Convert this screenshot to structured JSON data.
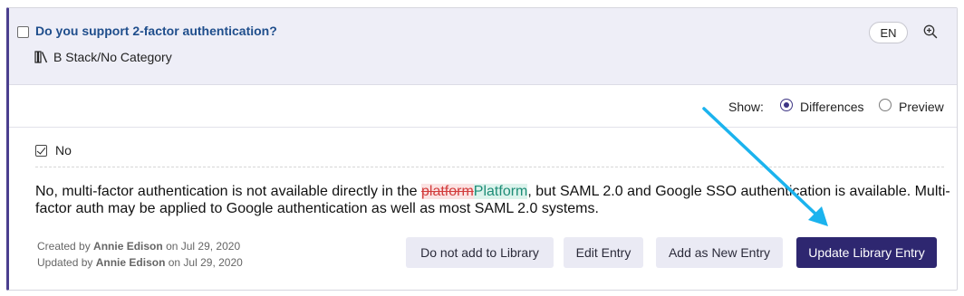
{
  "entry": {
    "question": "Do you support 2-factor authentication?",
    "category": "B Stack/No Category",
    "language": "EN"
  },
  "show": {
    "label": "Show:",
    "options": [
      {
        "label": "Differences",
        "selected": true
      },
      {
        "label": "Preview",
        "selected": false
      }
    ]
  },
  "answer": {
    "choice": "No",
    "text_before": "No, multi-factor authentication is not available directly in the ",
    "deleted": "platform",
    "inserted": "Platform",
    "text_after": ", but SAML 2.0 and Google SSO authentication is available. Multi-factor auth may be applied to Google authentication as well as most SAML 2.0 systems."
  },
  "meta": {
    "created_prefix": "Created by",
    "created_by": "Annie Edison",
    "created_on": "on Jul 29, 2020",
    "updated_prefix": "Updated by",
    "updated_by": "Annie Edison",
    "updated_on": "on Jul 29, 2020"
  },
  "actions": {
    "do_not_add": "Do not add to Library",
    "edit": "Edit Entry",
    "add_new": "Add as New Entry",
    "update": "Update Library Entry"
  },
  "colors": {
    "accent": "#2e2770",
    "header_bg": "#eeeef7",
    "question_link": "#1f4e8c",
    "diff_deleted": "#d23c3c",
    "diff_inserted": "#1e8d77",
    "annotation_arrow": "#1bb3ee"
  },
  "icons": {
    "category": "library-icon",
    "zoom": "zoom-in-icon"
  }
}
